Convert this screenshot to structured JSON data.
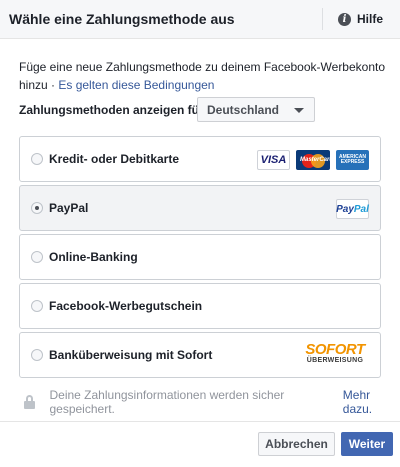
{
  "header": {
    "title": "Wähle eine Zahlungsmethode aus",
    "help_icon_glyph": "i",
    "help_label": "Hilfe"
  },
  "intro": {
    "text": "Füge eine neue Zahlungsmethode zu deinem Facebook-Werbekonto hinzu · ",
    "link": "Es gelten diese Bedingungen"
  },
  "country": {
    "label": "Zahlungsmethoden anzeigen für:",
    "selected": "Deutschland"
  },
  "options": [
    {
      "label": "Kredit- oder Debitkarte",
      "selected": false,
      "logos": [
        "visa-logo",
        "mastercard-logo",
        "amex-logo"
      ]
    },
    {
      "label": "PayPal",
      "selected": true,
      "logos": [
        "paypal-logo"
      ]
    },
    {
      "label": "Online-Banking",
      "selected": false,
      "logos": []
    },
    {
      "label": "Facebook-Werbegutschein",
      "selected": false,
      "logos": []
    },
    {
      "label": "Banküberweisung mit Sofort",
      "selected": false,
      "logos": [
        "sofort-logo"
      ]
    }
  ],
  "logos": {
    "visa": "VISA",
    "mastercard": "MasterCard",
    "amex_1": "AMERICAN",
    "amex_2": "EXPRESS",
    "paypal_1": "Pay",
    "paypal_2": "Pal",
    "sofort_main": "SOFORT",
    "sofort_sub": "ÜBERWEISUNG"
  },
  "secure": {
    "text": "Deine Zahlungsinformationen werden sicher gespeichert.",
    "link": "Mehr dazu."
  },
  "footer": {
    "cancel_label": "Abbrechen",
    "next_label": "Weiter"
  },
  "colors": {
    "primary": "#4267b2",
    "link": "#365899",
    "header_bg": "#f6f7f9",
    "selected_bg": "#f2f3f5"
  }
}
